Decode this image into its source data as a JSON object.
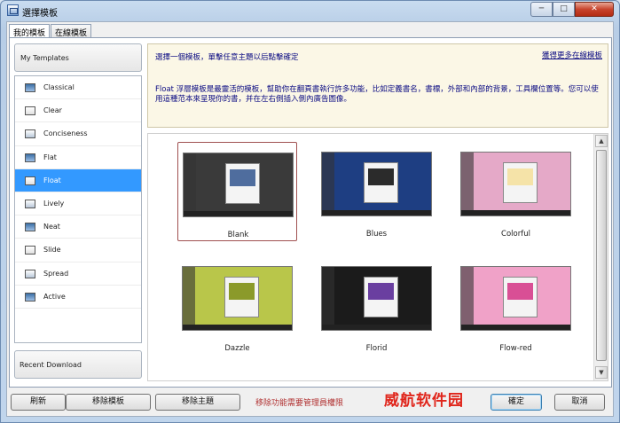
{
  "window": {
    "title": "選擇模板",
    "controls": {
      "minimize": "─",
      "maximize": "□",
      "close": "✕"
    }
  },
  "tabs": [
    {
      "label": "我的模板",
      "active": true
    },
    {
      "label": "在線模板",
      "active": false
    }
  ],
  "left_panel": {
    "header": "My Templates",
    "items": [
      {
        "label": "Classical",
        "icon": "template-classical-icon",
        "selected": false
      },
      {
        "label": "Clear",
        "icon": "template-clear-icon",
        "selected": false
      },
      {
        "label": "Conciseness",
        "icon": "template-conciseness-icon",
        "selected": false
      },
      {
        "label": "Flat",
        "icon": "template-flat-icon",
        "selected": false
      },
      {
        "label": "Float",
        "icon": "template-float-icon",
        "selected": true
      },
      {
        "label": "Lively",
        "icon": "template-lively-icon",
        "selected": false
      },
      {
        "label": "Neat",
        "icon": "template-neat-icon",
        "selected": false
      },
      {
        "label": "Slide",
        "icon": "template-slide-icon",
        "selected": false
      },
      {
        "label": "Spread",
        "icon": "template-spread-icon",
        "selected": false
      },
      {
        "label": "Active",
        "icon": "template-active-icon",
        "selected": false
      }
    ],
    "footer": "Recent Download"
  },
  "info": {
    "instruction": "選擇一個模板，單擊任意主題以后點擊確定",
    "more_link": "獲得更多在線模板",
    "description": "Float 浮層模板是最靈活的模板，幫助你在翻頁書執行許多功能，比如定義書名，書標，外部和內部的背景，工具欄位置等。您可以使用這種范本來呈現你的書，并在左右側插入側內廣告圖像。"
  },
  "gallery": {
    "themes": [
      {
        "label": "Blank",
        "selected": true,
        "bg": "#3a3a3a",
        "accent": "#4f6d9e"
      },
      {
        "label": "Blues",
        "selected": false,
        "bg": "#1e3e82",
        "accent": "#2b2b2b"
      },
      {
        "label": "Colorful",
        "selected": false,
        "bg": "#e5a9c8",
        "accent": "#f5e3a8"
      },
      {
        "label": "Dazzle",
        "selected": false,
        "bg": "#b9c64a",
        "accent": "#8b9a2a"
      },
      {
        "label": "Florid",
        "selected": false,
        "bg": "#1b1b1b",
        "accent": "#6a3fa0"
      },
      {
        "label": "Flow-red",
        "selected": false,
        "bg": "#f0a2c8",
        "accent": "#d94f95"
      }
    ]
  },
  "buttons": {
    "refresh": "刷新",
    "remove_template": "移除模板",
    "remove_theme": "移除主題",
    "ok": "確定",
    "cancel": "取消"
  },
  "admin_warning": "移除功能需要管理員權限",
  "watermark": "威航软件园"
}
